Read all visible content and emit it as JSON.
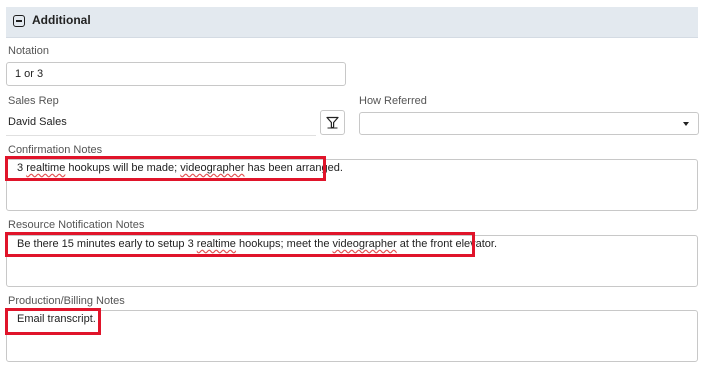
{
  "section": {
    "title": "Additional",
    "icon": "collapse-minus-icon"
  },
  "notation": {
    "label": "Notation",
    "value": "1 or 3"
  },
  "sales_rep": {
    "label": "Sales Rep",
    "value": "David Sales",
    "filter_icon": "filter-icon"
  },
  "how_referred": {
    "label": "How Referred",
    "value": "",
    "icon": "chevron-down-icon"
  },
  "confirmation_notes": {
    "label": "Confirmation Notes",
    "parts": [
      "3 ",
      "realtime",
      " hookups will be made; ",
      "videographer",
      " has been arranged."
    ]
  },
  "resource_notes": {
    "label": "Resource Notification Notes",
    "parts": [
      "Be there 15 minutes early to setup 3 ",
      "realtime",
      " hookups; meet the ",
      "videographer",
      " at the front elevator."
    ]
  },
  "production_notes": {
    "label": "Production/Billing Notes",
    "parts": [
      "Email transcript."
    ]
  },
  "colors": {
    "highlight": "#e0142a",
    "header_bg": "#e3e9ef",
    "spellcheck": "#e05050"
  }
}
